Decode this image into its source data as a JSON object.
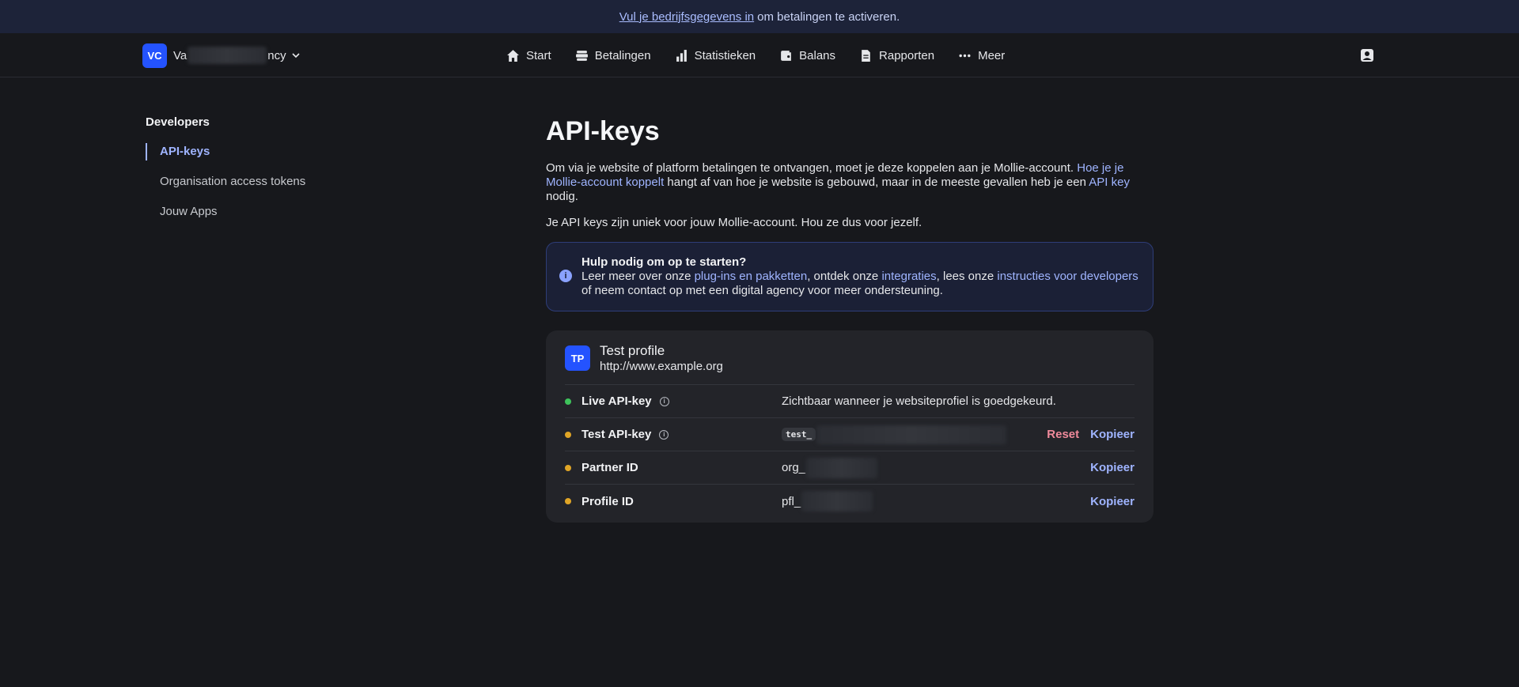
{
  "banner": {
    "link": "Vul je bedrijfsgegevens in",
    "text": "om betalingen te activeren."
  },
  "org": {
    "initials": "VC",
    "name_start": "Va",
    "name_end": "ncy"
  },
  "nav": {
    "start": "Start",
    "payments": "Betalingen",
    "stats": "Statistieken",
    "balance": "Balans",
    "reports": "Rapporten",
    "more": "Meer"
  },
  "sidebar": {
    "heading": "Developers",
    "items": [
      {
        "label": "API-keys"
      },
      {
        "label": "Organisation access tokens"
      },
      {
        "label": "Jouw Apps"
      }
    ]
  },
  "main": {
    "title": "API-keys",
    "intro_1": "Om via je website of platform betalingen te ontvangen, moet je deze koppelen aan je Mollie-account.",
    "intro_link_1": "Hoe je je Mollie-account koppelt",
    "intro_2": "hangt af van hoe je website is gebouwd, maar in de meeste gevallen heb je een",
    "intro_link_2": "API key",
    "intro_3": "nodig.",
    "unique": "Je API keys zijn uniek voor jouw Mollie-account. Hou ze dus voor jezelf."
  },
  "help": {
    "title": "Hulp nodig om op te starten?",
    "text_1": "Leer meer over onze",
    "link_1": "plug-ins en pakketten",
    "text_2": ", ontdek onze",
    "link_2": "integraties",
    "text_3": ", lees onze",
    "link_3": "instructies voor developers",
    "text_4": "of neem contact op met een digital agency voor meer ondersteuning."
  },
  "profile": {
    "initials": "TP",
    "name": "Test profile",
    "url": "http://www.example.org"
  },
  "keys": {
    "live_label": "Live API-key",
    "live_value": "Zichtbaar wanneer je websiteprofiel is goedgekeurd.",
    "test_label": "Test API-key",
    "test_prefix": "test_",
    "partner_label": "Partner ID",
    "partner_prefix": "org_",
    "profile_label": "Profile ID",
    "profile_prefix": "pfl_",
    "reset": "Reset",
    "copy": "Kopieer"
  },
  "colors": {
    "accent": "#2453ff",
    "link": "#9fb4ff",
    "live_dot": "#3ec35b",
    "test_dot": "#e0a526",
    "reset": "#f08a9b"
  }
}
